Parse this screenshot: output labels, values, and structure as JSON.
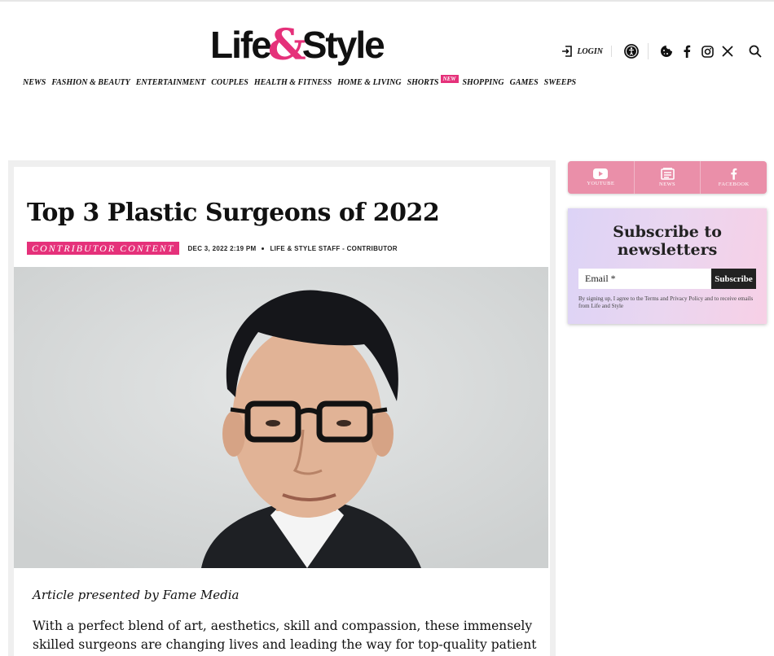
{
  "header": {
    "logo_left": "Life",
    "logo_amp": "&",
    "logo_right": "Style",
    "login_label": "LOGIN"
  },
  "nav": {
    "items": [
      "NEWS",
      "FASHION & BEAUTY",
      "ENTERTAINMENT",
      "COUPLES",
      "HEALTH & FITNESS",
      "HOME & LIVING",
      "SHORTS",
      "SHOPPING",
      "GAMES",
      "SWEEPS"
    ],
    "new_badge": "NEW"
  },
  "article": {
    "title": "Top 3 Plastic Surgeons of 2022",
    "badge": "CONTRIBUTOR CONTENT",
    "date": "DEC 3, 2022 2:19 PM",
    "author": "LIFE & STYLE STAFF - CONTRIBUTOR",
    "presented_by": "Article presented by Fame Media",
    "body": "With a perfect blend of art, aesthetics, skill and compassion, these immensely skilled surgeons are changing lives and leading the way for top-quality patient care."
  },
  "social": {
    "youtube": "YOUTUBE",
    "news": "NEWS",
    "facebook": "FACEBOOK"
  },
  "newsletter": {
    "title": "Subscribe to newsletters",
    "email_placeholder": "Email *",
    "subscribe_label": "Subscribe",
    "note": "By signing up, I agree to the Terms and Privacy Policy and to receive emails from Life and Style"
  },
  "colors": {
    "brand_pink": "#e5317a",
    "social_pink": "#ea8fa9"
  }
}
